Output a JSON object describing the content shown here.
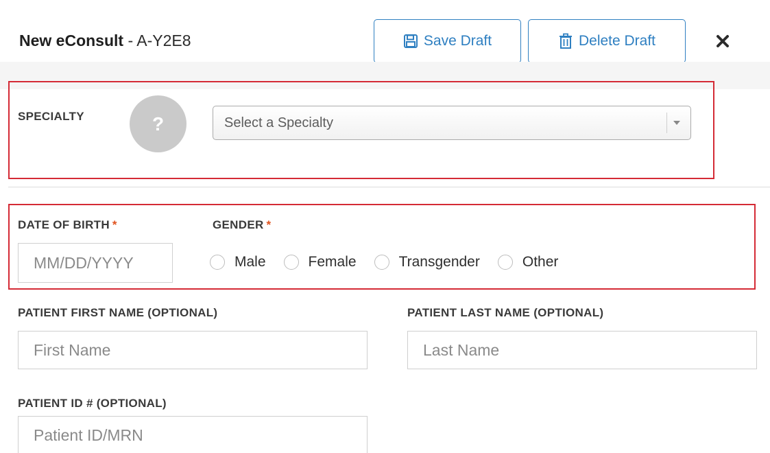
{
  "header": {
    "title_bold": "New eConsult",
    "title_rest": " - A-Y2E8",
    "save_draft_label": "Save Draft",
    "delete_draft_label": "Delete Draft",
    "close_icon": "close-icon"
  },
  "specialty": {
    "label": "SPECIALTY",
    "help_glyph": "?",
    "select_placeholder": "Select a Specialty"
  },
  "dob": {
    "label": "DATE OF BIRTH",
    "required_mark": "*",
    "placeholder": "MM/DD/YYYY",
    "value": ""
  },
  "gender": {
    "label": "GENDER",
    "required_mark": "*",
    "options": [
      "Male",
      "Female",
      "Transgender",
      "Other"
    ],
    "selected": null
  },
  "first_name": {
    "label": "PATIENT FIRST NAME (OPTIONAL)",
    "placeholder": "First Name",
    "value": ""
  },
  "last_name": {
    "label": "PATIENT LAST NAME (OPTIONAL)",
    "placeholder": "Last Name",
    "value": ""
  },
  "patient_id": {
    "label": "PATIENT ID # (OPTIONAL)",
    "placeholder": "Patient ID/MRN",
    "value": ""
  },
  "colors": {
    "accent": "#2e7fc1",
    "highlight": "#d42a35",
    "required": "#e0531f"
  }
}
